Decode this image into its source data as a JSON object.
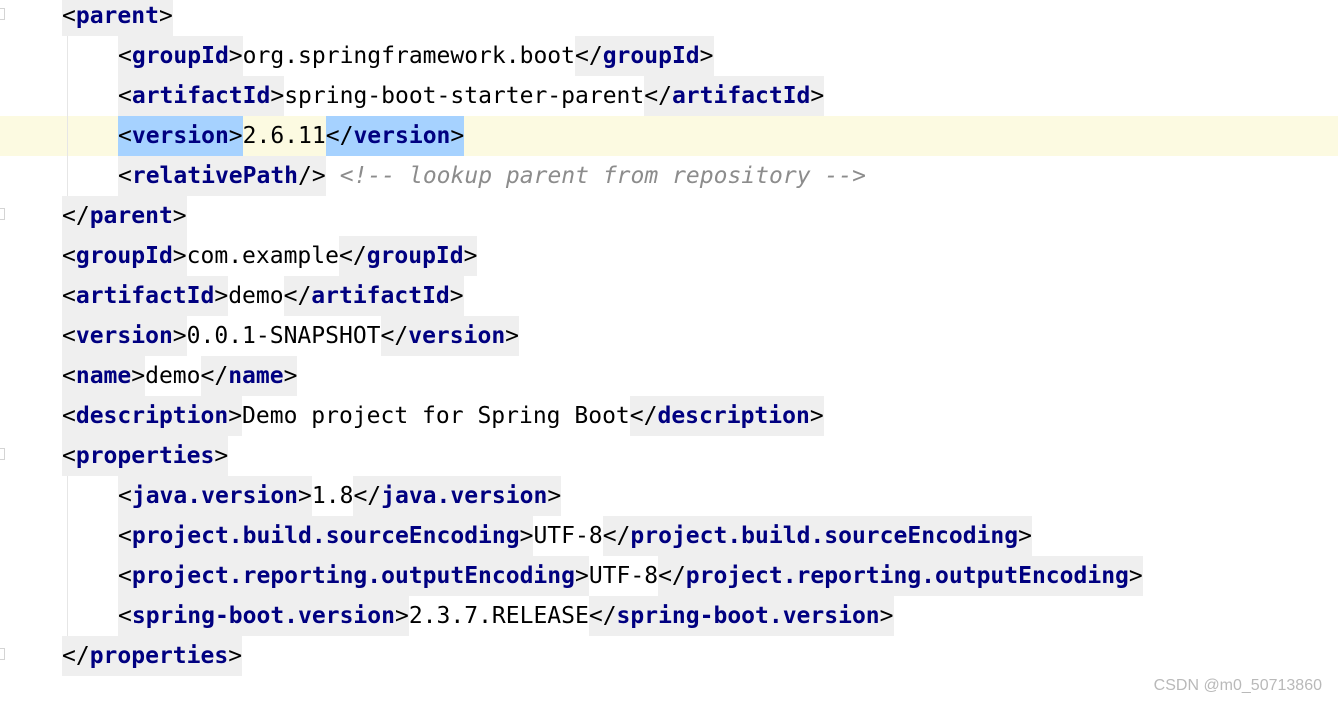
{
  "editor": {
    "lines": [
      {
        "id": "parent-open",
        "parts": [
          {
            "type": "tag",
            "close": false,
            "name": "parent"
          }
        ]
      },
      {
        "id": "parent-groupid",
        "parts": [
          {
            "type": "tag",
            "close": false,
            "name": "groupId"
          },
          {
            "type": "text",
            "value": "org.springframework.boot"
          },
          {
            "type": "tag",
            "close": true,
            "name": "groupId"
          }
        ]
      },
      {
        "id": "parent-artifactid",
        "parts": [
          {
            "type": "tag",
            "close": false,
            "name": "artifactId"
          },
          {
            "type": "text",
            "value": "spring-boot-starter-parent"
          },
          {
            "type": "tag",
            "close": true,
            "name": "artifactId"
          }
        ]
      },
      {
        "id": "parent-version",
        "current": true,
        "parts": [
          {
            "type": "tag",
            "close": false,
            "name": "version",
            "selected": true
          },
          {
            "type": "text",
            "value": "2.6.11"
          },
          {
            "type": "tag",
            "close": true,
            "name": "version",
            "selected": true
          }
        ]
      },
      {
        "id": "parent-relativepath",
        "parts": [
          {
            "type": "tag",
            "selfclose": true,
            "name": "relativePath"
          },
          {
            "type": "comment",
            "value": "<!-- lookup parent from repository -->"
          }
        ]
      },
      {
        "id": "parent-close",
        "parts": [
          {
            "type": "tag",
            "close": true,
            "name": "parent"
          }
        ]
      },
      {
        "id": "groupid",
        "parts": [
          {
            "type": "tag",
            "close": false,
            "name": "groupId"
          },
          {
            "type": "text",
            "value": "com.example"
          },
          {
            "type": "tag",
            "close": true,
            "name": "groupId"
          }
        ]
      },
      {
        "id": "artifactid",
        "parts": [
          {
            "type": "tag",
            "close": false,
            "name": "artifactId"
          },
          {
            "type": "text",
            "value": "demo"
          },
          {
            "type": "tag",
            "close": true,
            "name": "artifactId"
          }
        ]
      },
      {
        "id": "version",
        "parts": [
          {
            "type": "tag",
            "close": false,
            "name": "version"
          },
          {
            "type": "text",
            "value": "0.0.1-SNAPSHOT"
          },
          {
            "type": "tag",
            "close": true,
            "name": "version"
          }
        ]
      },
      {
        "id": "name",
        "parts": [
          {
            "type": "tag",
            "close": false,
            "name": "name"
          },
          {
            "type": "text",
            "value": "demo"
          },
          {
            "type": "tag",
            "close": true,
            "name": "name"
          }
        ]
      },
      {
        "id": "description",
        "parts": [
          {
            "type": "tag",
            "close": false,
            "name": "description"
          },
          {
            "type": "text",
            "value": "Demo project for Spring Boot"
          },
          {
            "type": "tag",
            "close": true,
            "name": "description"
          }
        ]
      },
      {
        "id": "properties-open",
        "parts": [
          {
            "type": "tag",
            "close": false,
            "name": "properties"
          }
        ]
      },
      {
        "id": "java-version",
        "parts": [
          {
            "type": "tag",
            "close": false,
            "name": "java.version"
          },
          {
            "type": "text",
            "value": "1.8"
          },
          {
            "type": "tag",
            "close": true,
            "name": "java.version"
          }
        ]
      },
      {
        "id": "source-encoding",
        "parts": [
          {
            "type": "tag",
            "close": false,
            "name": "project.build.sourceEncoding"
          },
          {
            "type": "text",
            "value": "UTF-8"
          },
          {
            "type": "tag",
            "close": true,
            "name": "project.build.sourceEncoding"
          }
        ]
      },
      {
        "id": "output-encoding",
        "parts": [
          {
            "type": "tag",
            "close": false,
            "name": "project.reporting.outputEncoding"
          },
          {
            "type": "text",
            "value": "UTF-8"
          },
          {
            "type": "tag",
            "close": true,
            "name": "project.reporting.outputEncoding"
          }
        ]
      },
      {
        "id": "spring-boot-version",
        "parts": [
          {
            "type": "tag",
            "close": false,
            "name": "spring-boot.version"
          },
          {
            "type": "text",
            "value": "2.3.7.RELEASE"
          },
          {
            "type": "tag",
            "close": true,
            "name": "spring-boot.version"
          }
        ]
      },
      {
        "id": "properties-close",
        "parts": [
          {
            "type": "tag",
            "close": true,
            "name": "properties"
          }
        ]
      }
    ]
  },
  "watermark": "CSDN @m0_50713860"
}
